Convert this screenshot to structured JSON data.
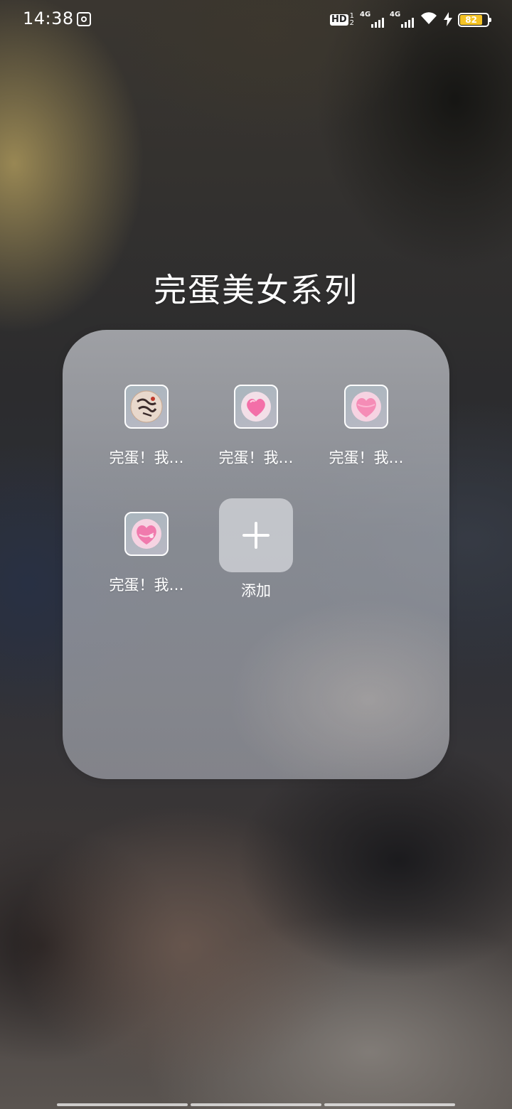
{
  "status_bar": {
    "time": "14:38",
    "hd_label": "HD",
    "hd_sub_top": "1",
    "hd_sub_bottom": "2",
    "sim1_network": "4G",
    "sim2_network": "4G",
    "battery_level": "82",
    "battery_color": "#f4c325"
  },
  "folder": {
    "title": "完蛋美女系列",
    "apps": [
      {
        "label": "完蛋！我…",
        "icon": "calligraphy-avatar-icon"
      },
      {
        "label": "完蛋！我…",
        "icon": "pink-heart-icon"
      },
      {
        "label": "完蛋！我…",
        "icon": "pink-heart-icon"
      },
      {
        "label": "完蛋！我…",
        "icon": "pink-heart-icon"
      }
    ],
    "add_label": "添加"
  }
}
